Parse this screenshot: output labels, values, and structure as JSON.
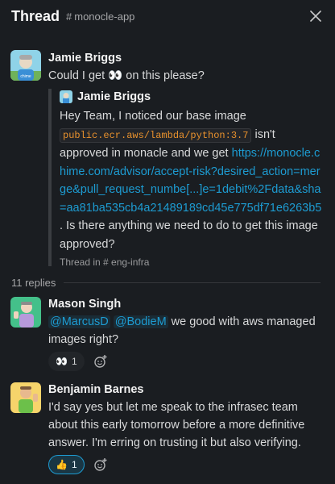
{
  "header": {
    "title": "Thread",
    "channel_name": "monocle-app",
    "close_icon": "close-icon"
  },
  "parent_message": {
    "author": "Jamie Briggs",
    "text_before": "Could I get",
    "emoji": "👀",
    "text_after": "on this please?",
    "shared": {
      "author": "Jamie Briggs",
      "text_1": "Hey Team, I noticed our base image ",
      "code": "public.ecr.aws/lambda/python:3.7",
      "text_2": " isn't approved in monacle and we get ",
      "link": "https://monocle.chime.com/advisor/accept-risk?desired_action=merge&pull_request_numbe[...]e=1debit%2Fdata&sha=aa81ba535cb4a21489189cd45e775df71e6263b5",
      "text_3": " . Is there anything we need to do to get this image approved?",
      "footer": "Thread in # eng-infra"
    }
  },
  "replies_label": "11 replies",
  "replies": [
    {
      "author": "Mason Singh",
      "mention_1": "@MarcusD",
      "mention_2": "@BodieM",
      "text": " we good with aws managed images right?",
      "reaction_emoji": "👀",
      "reaction_count": "1"
    },
    {
      "author": "Benjamin Barnes",
      "text": "I'd say yes but let me speak to the infrasec team about this early tomorrow before a more definitive answer. I'm erring on trusting it but also verifying.",
      "reaction_emoji": "👍",
      "reaction_count": "1"
    }
  ],
  "colors": {
    "background": "#1a1d21",
    "link": "#1d9bd1",
    "code": "#e8912d"
  }
}
